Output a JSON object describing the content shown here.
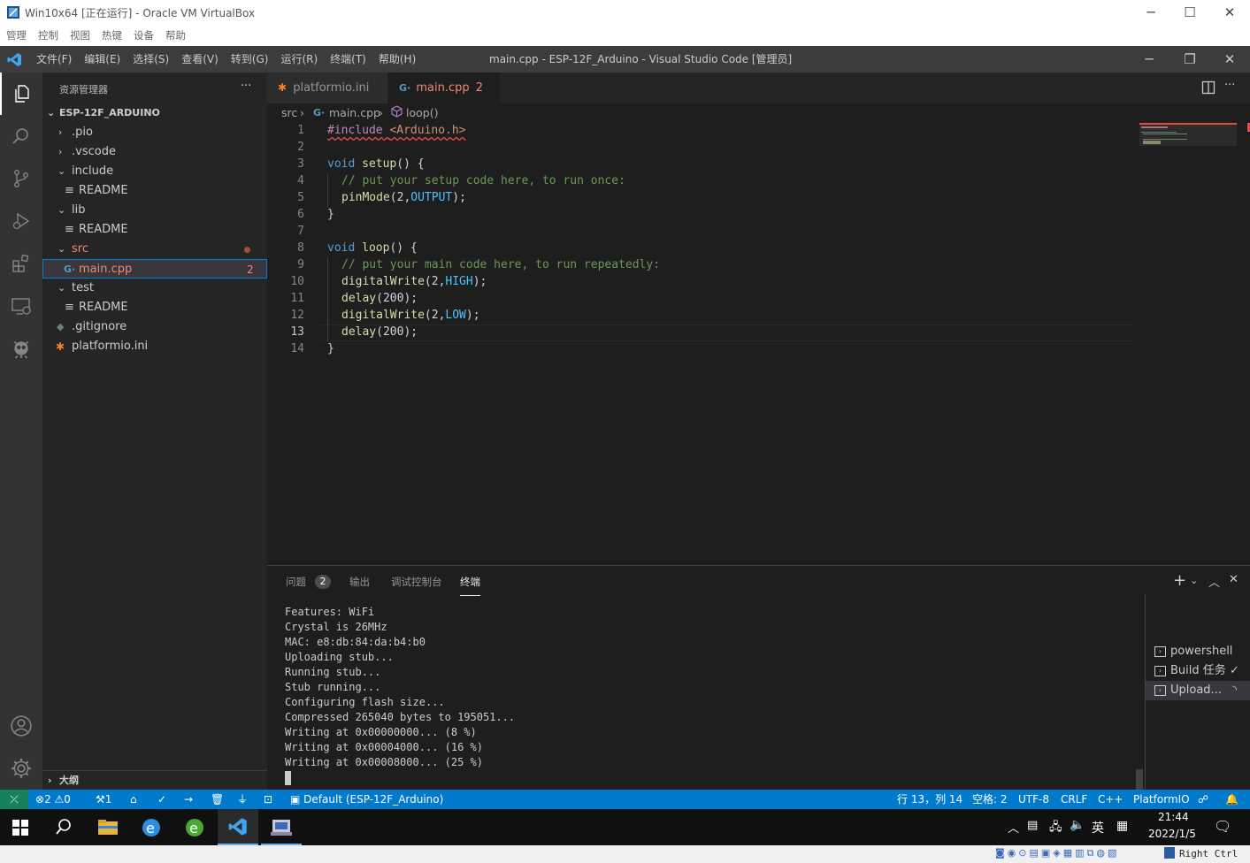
{
  "vbox": {
    "title": "Win10x64 [正在运行] - Oracle VM VirtualBox",
    "menu": [
      "管理",
      "控制",
      "视图",
      "热键",
      "设备",
      "帮助"
    ],
    "host_key": "Right Ctrl"
  },
  "vscode": {
    "menu": [
      "文件(F)",
      "编辑(E)",
      "选择(S)",
      "查看(V)",
      "转到(G)",
      "运行(R)",
      "终端(T)",
      "帮助(H)"
    ],
    "window_title": "main.cpp - ESP-12F_Arduino - Visual Studio Code [管理员]"
  },
  "sidebar": {
    "header": "资源管理器",
    "more": "···",
    "project": "ESP-12F_ARDUINO",
    "items": [
      {
        "label": ".pio",
        "chev": "›",
        "indent": 1
      },
      {
        "label": ".vscode",
        "chev": "›",
        "indent": 1
      },
      {
        "label": "include",
        "chev": "⌄",
        "indent": 1
      },
      {
        "label": "README",
        "indent": 2
      },
      {
        "label": "lib",
        "chev": "⌄",
        "indent": 1
      },
      {
        "label": "README",
        "indent": 2
      },
      {
        "label": "src",
        "chev": "⌄",
        "indent": 1
      },
      {
        "label": "main.cpp",
        "indent": 2,
        "badge": "2"
      },
      {
        "label": "test",
        "chev": "⌄",
        "indent": 1
      },
      {
        "label": "README",
        "indent": 2
      },
      {
        "label": ".gitignore",
        "indent": 1
      },
      {
        "label": "platformio.ini",
        "indent": 1
      }
    ],
    "outline": "大纲"
  },
  "tabs": [
    {
      "label": "platformio.ini"
    },
    {
      "label": "main.cpp",
      "badge": "2"
    }
  ],
  "breadcrumb": {
    "folder": "src",
    "file": "main.cpp",
    "symbol": "loop()"
  },
  "code": {
    "line_numbers": [
      "1",
      "2",
      "3",
      "4",
      "5",
      "6",
      "7",
      "8",
      "9",
      "10",
      "11",
      "12",
      "13",
      "14"
    ],
    "l1_a": "#include",
    "l1_b": "<Arduino.h>",
    "l3_a": "void",
    "l3_b": "setup",
    "l3_c": "() {",
    "l4": "// put your setup code here, to run once:",
    "l5_a": "pinMode",
    "l5_b": "(2,",
    "l5_c": "OUTPUT",
    "l5_d": ");",
    "l6": "}",
    "l8_a": "void",
    "l8_b": "loop",
    "l8_c": "() {",
    "l9": "// put your main code here, to run repeatedly:",
    "l10_a": "digitalWrite",
    "l10_b": "(2,",
    "l10_c": "HIGH",
    "l10_d": ");",
    "l11_a": "delay",
    "l11_b": "(200);",
    "l12_a": "digitalWrite",
    "l12_b": "(2,",
    "l12_c": "LOW",
    "l12_d": ");",
    "l13_a": "delay",
    "l13_b": "(200);",
    "l14": "}"
  },
  "panel": {
    "tabs": [
      "问题",
      "输出",
      "调试控制台",
      "终端"
    ],
    "problems_count": "2",
    "terminal_lines": [
      "Features: WiFi",
      "Crystal is 26MHz",
      "MAC: e8:db:84:da:b4:b0",
      "Uploading stub...",
      "Running stub...",
      "Stub running...",
      "Configuring flash size...",
      "Compressed 265040 bytes to 195051...",
      "Writing at 0x00000000... (8 %)",
      "Writing at 0x00004000... (16 %)",
      "Writing at 0x00008000... (25 %)"
    ],
    "terminals": [
      "powershell",
      "Build 任务",
      "Upload..."
    ]
  },
  "status": {
    "errors": "2",
    "warnings": "0",
    "ports": "1",
    "env": "Default (ESP-12F_Arduino)",
    "position": "行 13，列 14",
    "indent": "空格: 2",
    "encoding": "UTF-8",
    "eol": "CRLF",
    "language": "C++",
    "platformio": "PlatformIO"
  },
  "taskbar": {
    "time": "21:44",
    "date": "2022/1/5",
    "ime": "英"
  },
  "colors": {
    "accent": "#007acc",
    "error": "#f14c4c",
    "modified": "#e2c08d"
  }
}
